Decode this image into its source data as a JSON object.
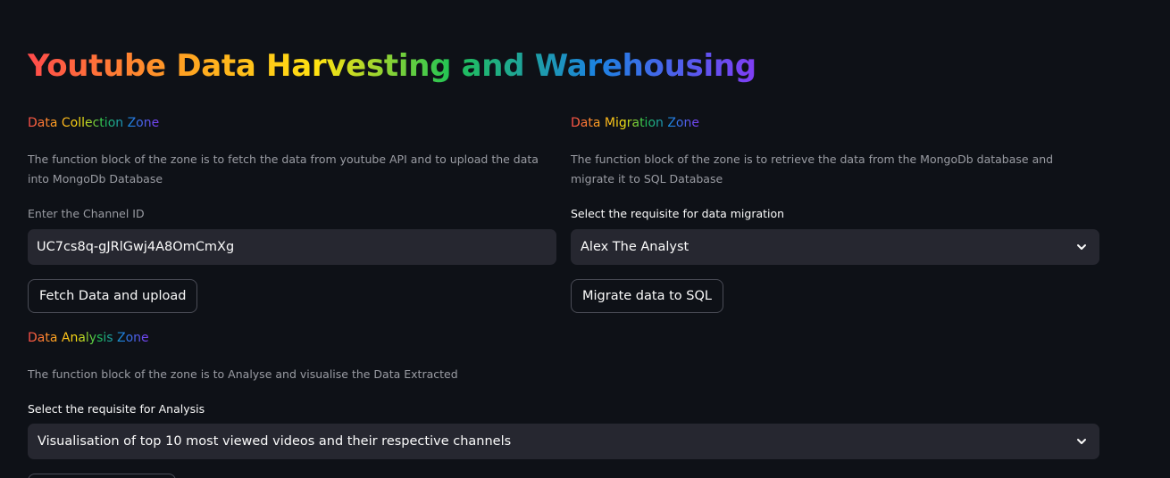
{
  "page": {
    "title": "Youtube Data Harvesting and Warehousing"
  },
  "collection": {
    "heading": "Data Collection Zone",
    "description": "The function block of the zone is to fetch the data from youtube API and to upload the data into MongoDb Database",
    "input_label": "Enter the Channel ID",
    "channel_id_value": "UC7cs8q-gJRlGwj4A8OmCmXg",
    "button_label": "Fetch Data and upload"
  },
  "migration": {
    "heading": "Data Migration Zone",
    "description": "The function block of the zone is to retrieve the data from the MongoDb database and migrate it to SQL Database",
    "select_label": "Select the requisite for data migration",
    "selected_value": "Alex The Analyst",
    "button_label": "Migrate data to SQL"
  },
  "analysis": {
    "heading": "Data Analysis Zone",
    "description": "The function block of the zone is to Analyse and visualise the Data Extracted",
    "select_label": "Select the requisite for Analysis",
    "selected_value": "Visualisation of top 10 most viewed videos and their respective channels"
  },
  "icons": {
    "dropdown": "chevron-down-icon"
  },
  "colors": {
    "background": "#0e1117",
    "input_background": "#262730",
    "muted_text": "#9a9ca3",
    "rainbow": [
      "#ff4b4b",
      "#ffa421",
      "#ffe312",
      "#21c354",
      "#1c83e1",
      "#803df5"
    ]
  }
}
